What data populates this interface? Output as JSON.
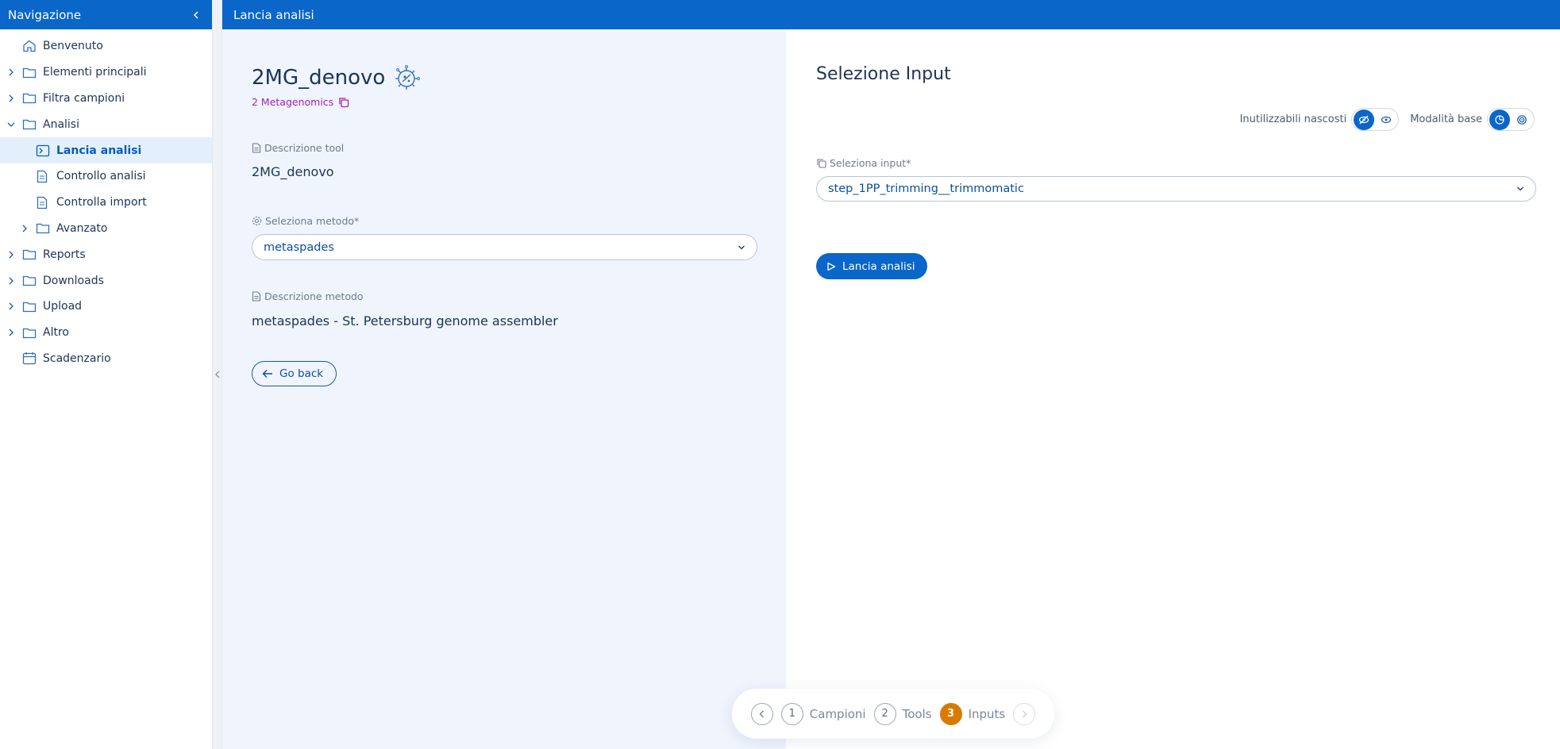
{
  "sidebar": {
    "title": "Navigazione",
    "items": [
      {
        "label": "Benvenuto"
      },
      {
        "label": "Elementi principali"
      },
      {
        "label": "Filtra campioni"
      },
      {
        "label": "Analisi"
      },
      {
        "label": "Lancia analisi"
      },
      {
        "label": "Controllo analisi"
      },
      {
        "label": "Controlla import"
      },
      {
        "label": "Avanzato"
      },
      {
        "label": "Reports"
      },
      {
        "label": "Downloads"
      },
      {
        "label": "Upload"
      },
      {
        "label": "Altro"
      },
      {
        "label": "Scadenzario"
      }
    ]
  },
  "topbar": {
    "title": "Lancia analisi"
  },
  "tool": {
    "name": "2MG_denovo",
    "category": "2 Metagenomics",
    "description_label": "Descrizione tool",
    "description": "2MG_denovo",
    "method_label": "Seleziona metodo*",
    "method_value": "metaspades",
    "method_description_label": "Descrizione metodo",
    "method_description": "metaspades - St. Petersburg genome assembler",
    "go_back": "Go back"
  },
  "inputs": {
    "title": "Selezione Input",
    "toggle_hidden_label": "Inutilizzabili nascosti",
    "toggle_mode_label": "Modalità base",
    "select_label": "Seleziona input*",
    "select_value": "step_1PP_trimming__trimmomatic",
    "launch_label": "Lancia analisi"
  },
  "stepper": {
    "steps": [
      {
        "num": "1",
        "label": "Campioni"
      },
      {
        "num": "2",
        "label": "Tools"
      },
      {
        "num": "3",
        "label": "Inputs"
      }
    ]
  },
  "colors": {
    "primary": "#0a66c8",
    "accent_category": "#a323b5",
    "step_current": "#d97a00"
  }
}
